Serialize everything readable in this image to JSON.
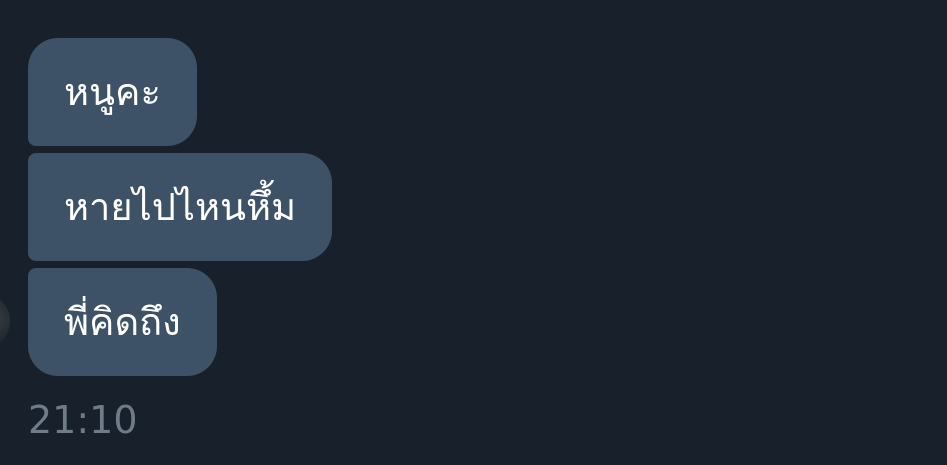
{
  "chat": {
    "messages": [
      {
        "text": "หนูคะ"
      },
      {
        "text": "หายไปไหนหึ้ม"
      },
      {
        "text": "พี่คิดถึง"
      }
    ],
    "timestamp": "21:10",
    "sender_avatar_icon": "avatar-icon"
  },
  "colors": {
    "background": "#18212b",
    "bubble": "#3d5266",
    "bubble_text": "#ffffff",
    "timestamp": "#6e7b88"
  }
}
